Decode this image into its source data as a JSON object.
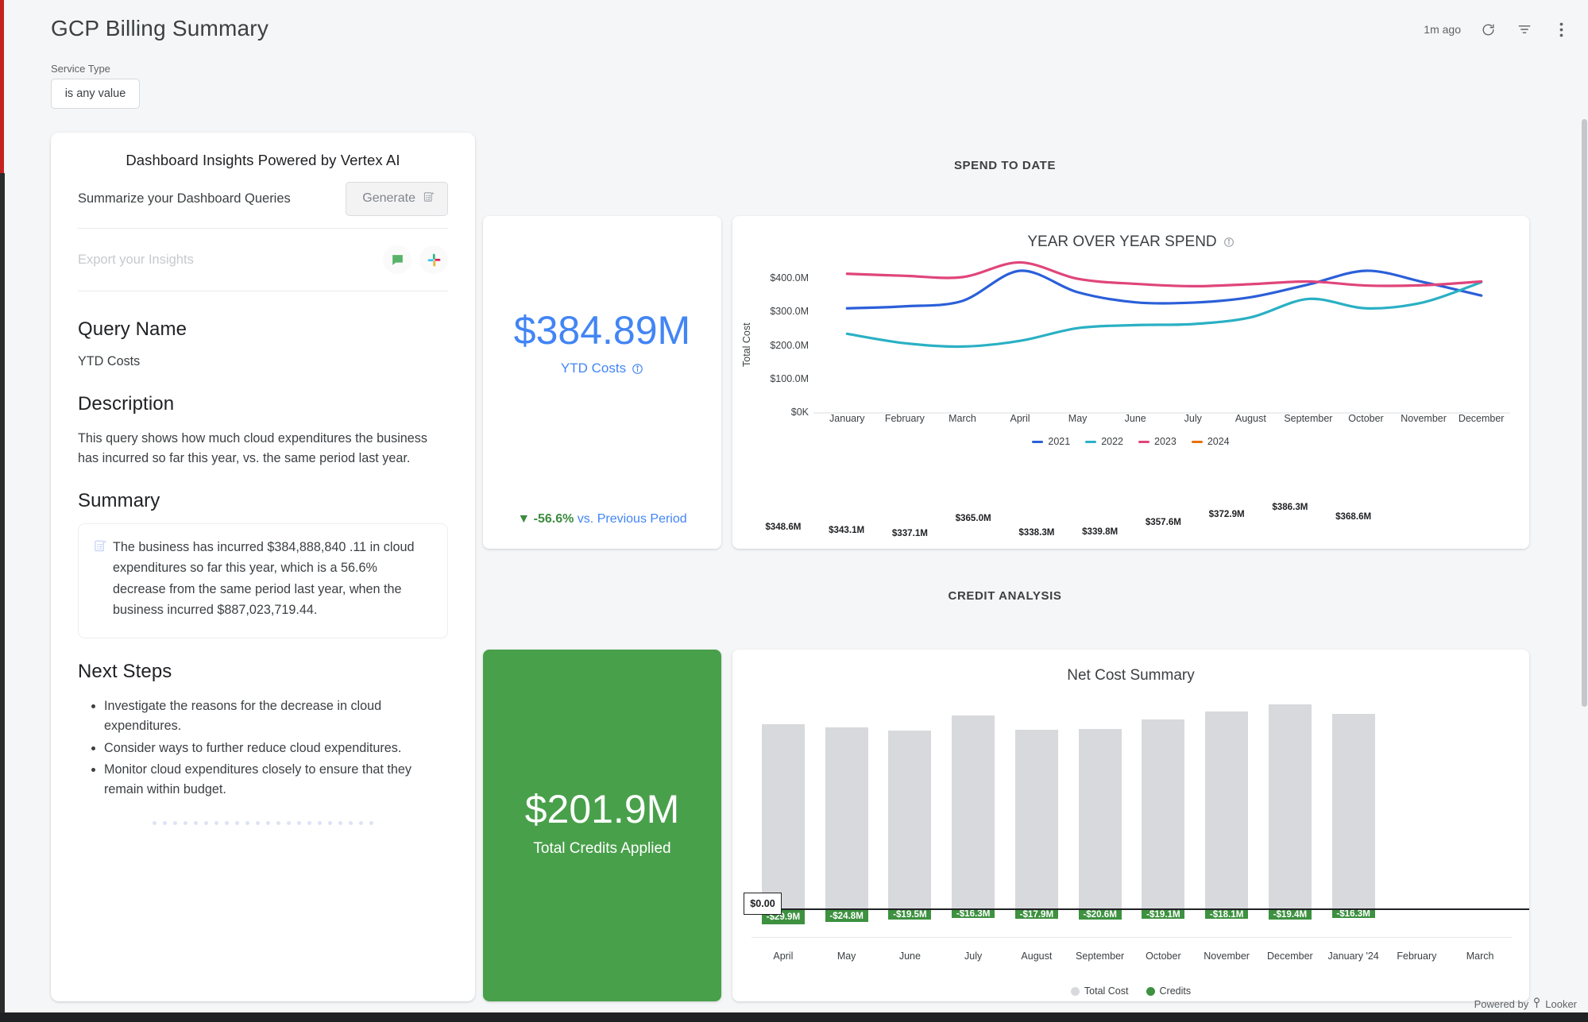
{
  "header": {
    "title": "GCP Billing Summary",
    "last_refresh": "1m ago",
    "refresh_icon": "refresh-icon",
    "filter_icon": "filter-icon",
    "more_icon": "kebab-menu-icon"
  },
  "filter": {
    "label": "Service Type",
    "value": "is any value"
  },
  "insights": {
    "title": "Dashboard Insights Powered by Vertex AI",
    "summarize_label": "Summarize your Dashboard Queries",
    "generate_button": "Generate",
    "export_label": "Export your Insights",
    "export_icons": [
      "google-chat-icon",
      "slack-icon"
    ],
    "query_name_heading": "Query Name",
    "query_name": "YTD Costs",
    "description_heading": "Description",
    "description": "This query shows how much cloud expenditures the business has incurred so far this year, vs. the same period last year.",
    "summary_heading": "Summary",
    "summary_text": "The business has incurred $384,888,840 .11 in cloud expenditures so far this year, which is a 56.6% decrease from the same period last year, when the business incurred $887,023,719.44.",
    "next_steps_heading": "Next Steps",
    "next_steps": [
      "Investigate the reasons for the decrease in cloud expenditures.",
      "Consider ways to further reduce cloud expenditures.",
      "Monitor cloud expenditures closely to ensure that they remain within budget."
    ]
  },
  "sections": {
    "spend_to_date": "SPEND TO DATE",
    "credit_analysis": "CREDIT ANALYSIS"
  },
  "kpi_ytd": {
    "value": "$384.89M",
    "label": "YTD Costs",
    "info_icon": "info-icon",
    "delta_arrow": "▼",
    "delta": "-56.6%",
    "delta_suffix": " vs. Previous Period",
    "color": "#4285f4"
  },
  "kpi_credits": {
    "value": "$201.9M",
    "label": "Total Credits Applied",
    "color": "#49a04b"
  },
  "footer": {
    "powered_by": "Powered by",
    "brand": "Looker"
  },
  "chart_data": [
    {
      "type": "line",
      "title": "YEAR OVER YEAR SPEND",
      "info_icon": "info-icon",
      "xlabel": "",
      "ylabel": "Total Cost",
      "categories": [
        "January",
        "February",
        "March",
        "April",
        "May",
        "June",
        "July",
        "August",
        "September",
        "October",
        "November",
        "December"
      ],
      "ytick_labels": [
        "$400.0M",
        "$300.0M",
        "$200.0M",
        "$100.0M",
        "$0K"
      ],
      "ylim": [
        0,
        450
      ],
      "grid": false,
      "legend_position": "bottom",
      "series": [
        {
          "name": "2021",
          "color": "#2b5fd9",
          "values": [
            312,
            318,
            334,
            424,
            360,
            330,
            329,
            345,
            383,
            424,
            390,
            350
          ]
        },
        {
          "name": "2022",
          "color": "#2ab0c4",
          "values": [
            236,
            208,
            198,
            215,
            253,
            262,
            265,
            285,
            340,
            312,
            330,
            390
          ]
        },
        {
          "name": "2023",
          "color": "#e0457b",
          "values": [
            415,
            409,
            405,
            449,
            400,
            385,
            378,
            384,
            392,
            380,
            381,
            392
          ]
        },
        {
          "name": "2024",
          "color": "#e8710a",
          "values": []
        }
      ]
    },
    {
      "type": "bar",
      "title": "Net Cost Summary",
      "categories": [
        "April",
        "May",
        "June",
        "July",
        "August",
        "September",
        "October",
        "November",
        "December",
        "January '24",
        "February",
        "March"
      ],
      "zero_label": "$0.00",
      "legend_position": "bottom",
      "legend": [
        "Total Cost",
        "Credits"
      ],
      "series": [
        {
          "name": "Total Cost",
          "color": "#d7d9dc",
          "labels": [
            "$348.6M",
            "$343.1M",
            "$337.1M",
            "$365.0M",
            "$338.3M",
            "$339.8M",
            "$357.6M",
            "$372.9M",
            "$386.3M",
            "$368.6M"
          ],
          "values": [
            348.6,
            343.1,
            337.1,
            365.0,
            338.3,
            339.8,
            357.6,
            372.9,
            386.3,
            368.6
          ]
        },
        {
          "name": "Credits",
          "color": "#3d9140",
          "labels": [
            "-$29.9M",
            "-$24.8M",
            "-$19.5M",
            "-$16.3M",
            "-$17.9M",
            "-$20.6M",
            "-$19.1M",
            "-$18.1M",
            "-$19.4M",
            "-$16.3M"
          ],
          "values": [
            -29.9,
            -24.8,
            -19.5,
            -16.3,
            -17.9,
            -20.6,
            -19.1,
            -18.1,
            -19.4,
            -16.3
          ]
        }
      ]
    }
  ]
}
